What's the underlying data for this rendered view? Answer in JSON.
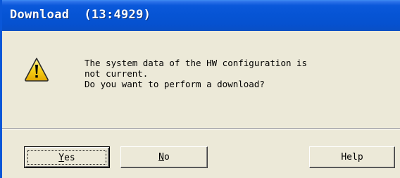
{
  "window": {
    "title": "Download  (13:4929)"
  },
  "icon": "warning-icon",
  "message": {
    "line1": "The system data of the HW configuration is",
    "line2": "not current.",
    "line3": "Do you want to perform a download?"
  },
  "buttons": {
    "yes_mnemonic": "Y",
    "yes_rest": "es",
    "no_mnemonic": "N",
    "no_rest": "o",
    "help_label": "Help"
  },
  "colors": {
    "titlebar": "#0654d4",
    "dialog_bg": "#ece9d8",
    "warning_fill": "#f8d21a",
    "warning_border": "#2b2b2b"
  }
}
